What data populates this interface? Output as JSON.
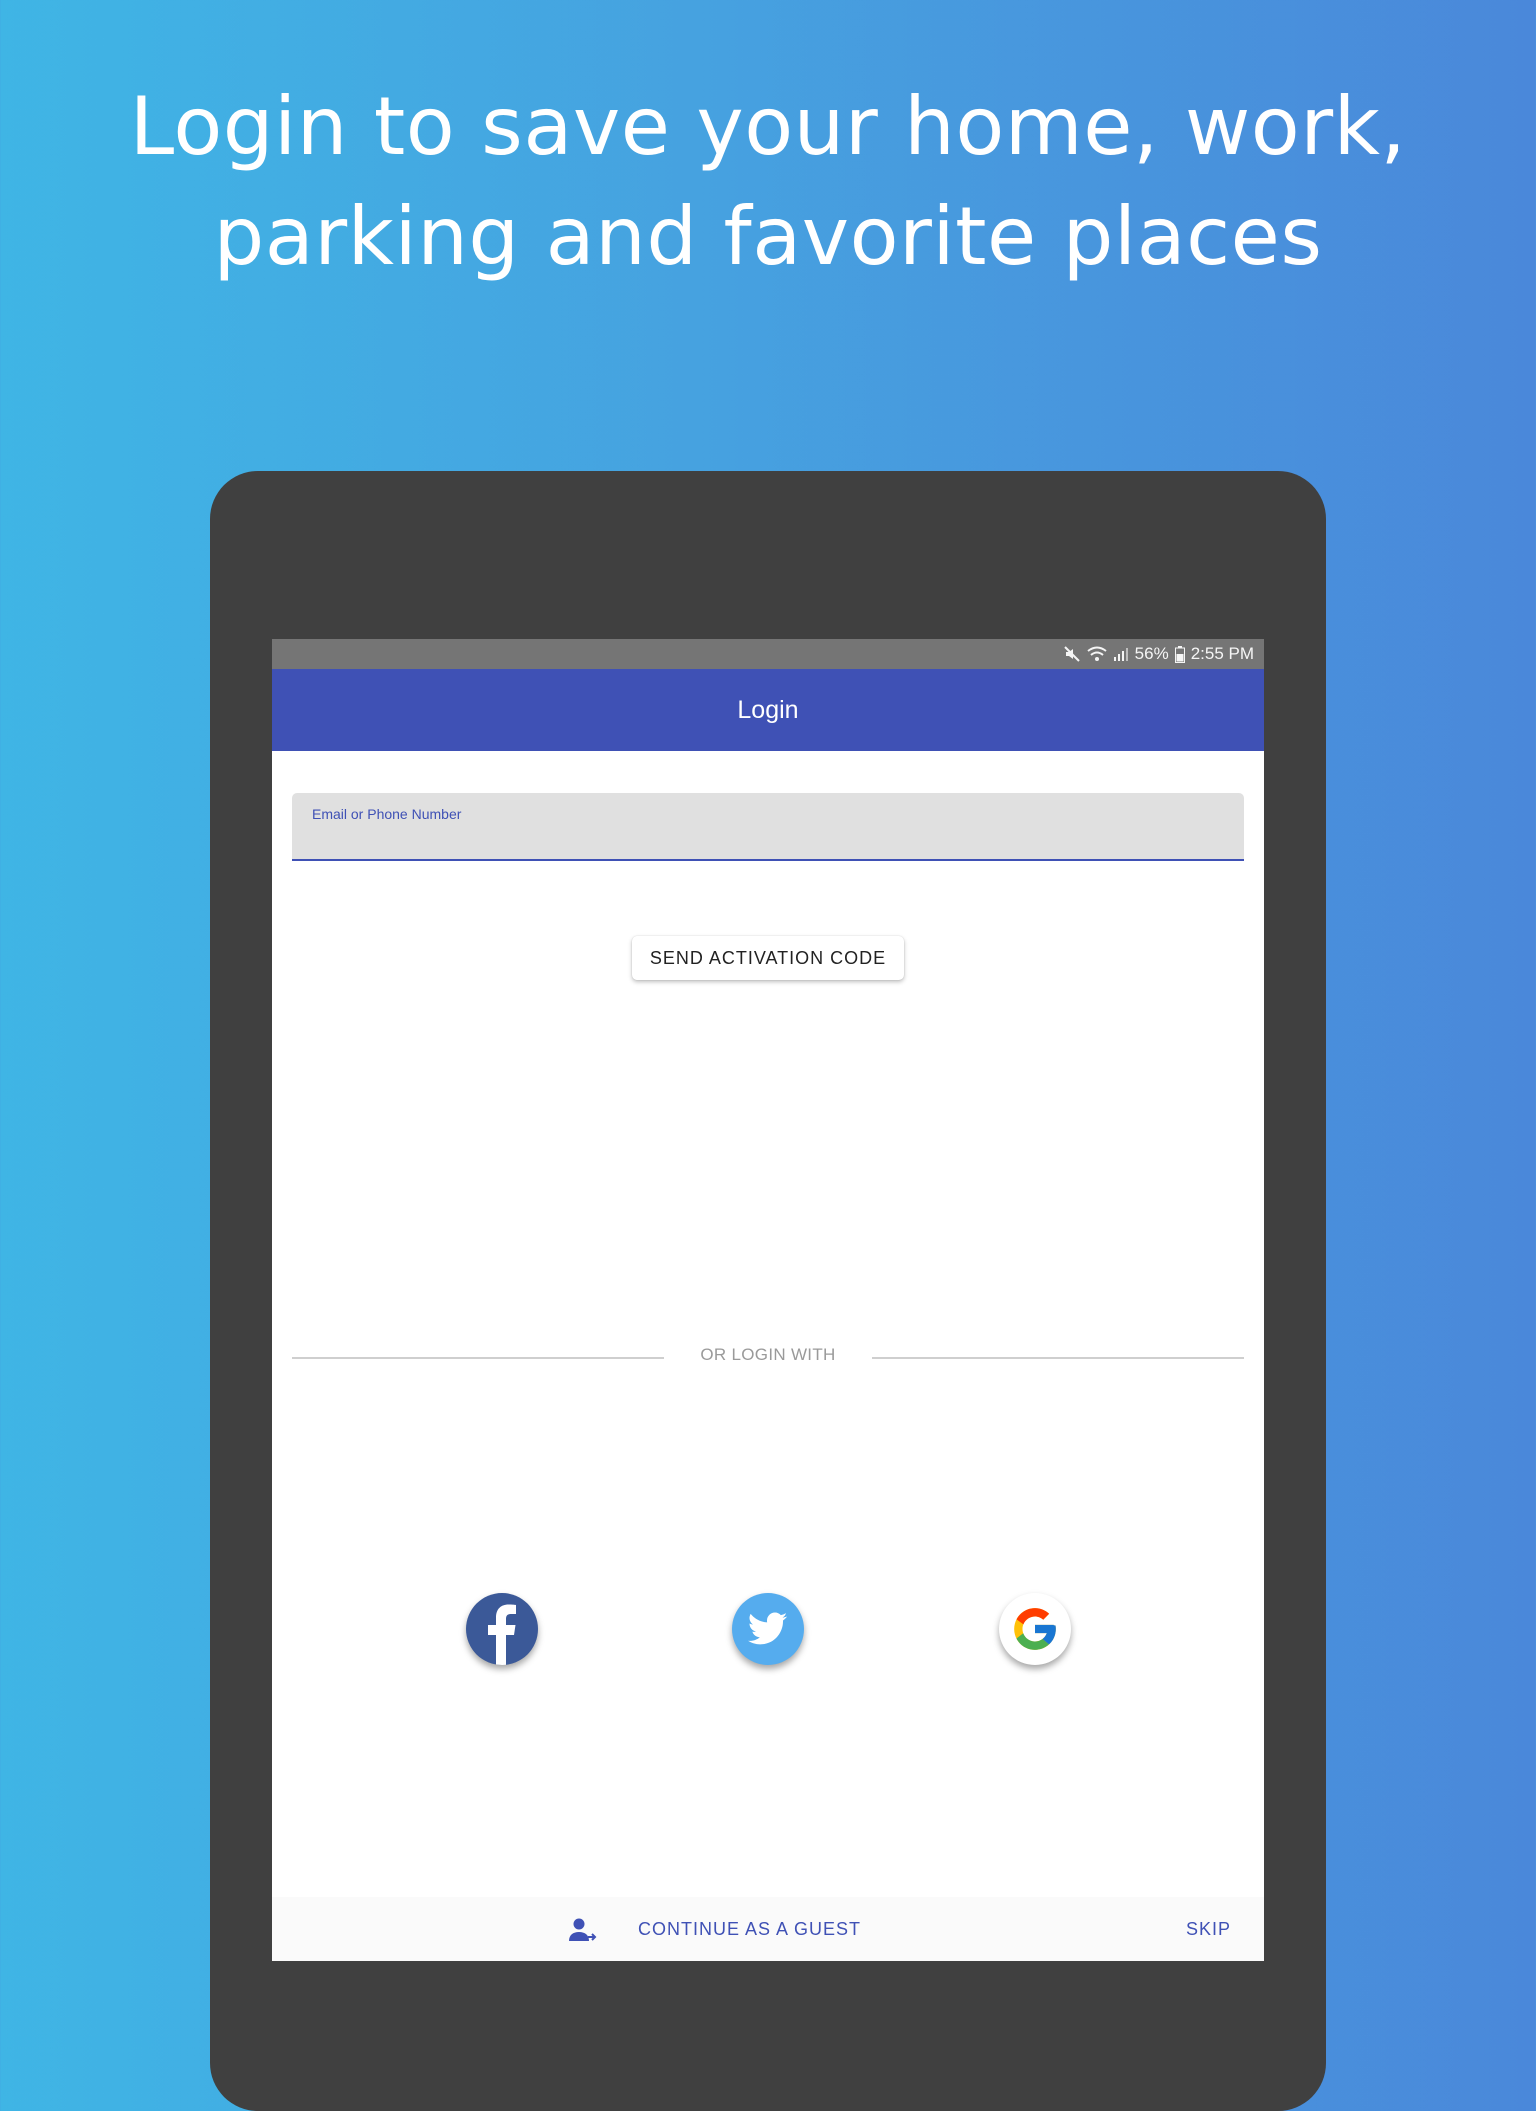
{
  "headline": {
    "line1": "Login to save your home, work,",
    "line2": "parking and favorite places"
  },
  "status_bar": {
    "battery": "56%",
    "time": "2:55 PM",
    "icons": [
      "mute-icon",
      "wifi-icon",
      "signal-icon",
      "battery-icon"
    ]
  },
  "app_bar": {
    "title": "Login"
  },
  "form": {
    "email_label": "Email or Phone Number",
    "email_value": "",
    "send_button": "SEND ACTIVATION CODE"
  },
  "divider": {
    "text": "OR LOGIN WITH"
  },
  "social": [
    {
      "name": "facebook",
      "icon": "facebook-icon",
      "color": "#3b5998"
    },
    {
      "name": "twitter",
      "icon": "twitter-icon",
      "color": "#55acee"
    },
    {
      "name": "google",
      "icon": "google-icon",
      "color": "#ffffff"
    }
  ],
  "footer": {
    "guest_label": "CONTINUE AS A GUEST",
    "skip_label": "SKIP",
    "guest_icon": "person-arrow-icon"
  },
  "colors": {
    "primary": "#3f51b5",
    "status_bar": "#757575",
    "device_frame": "#404040"
  }
}
